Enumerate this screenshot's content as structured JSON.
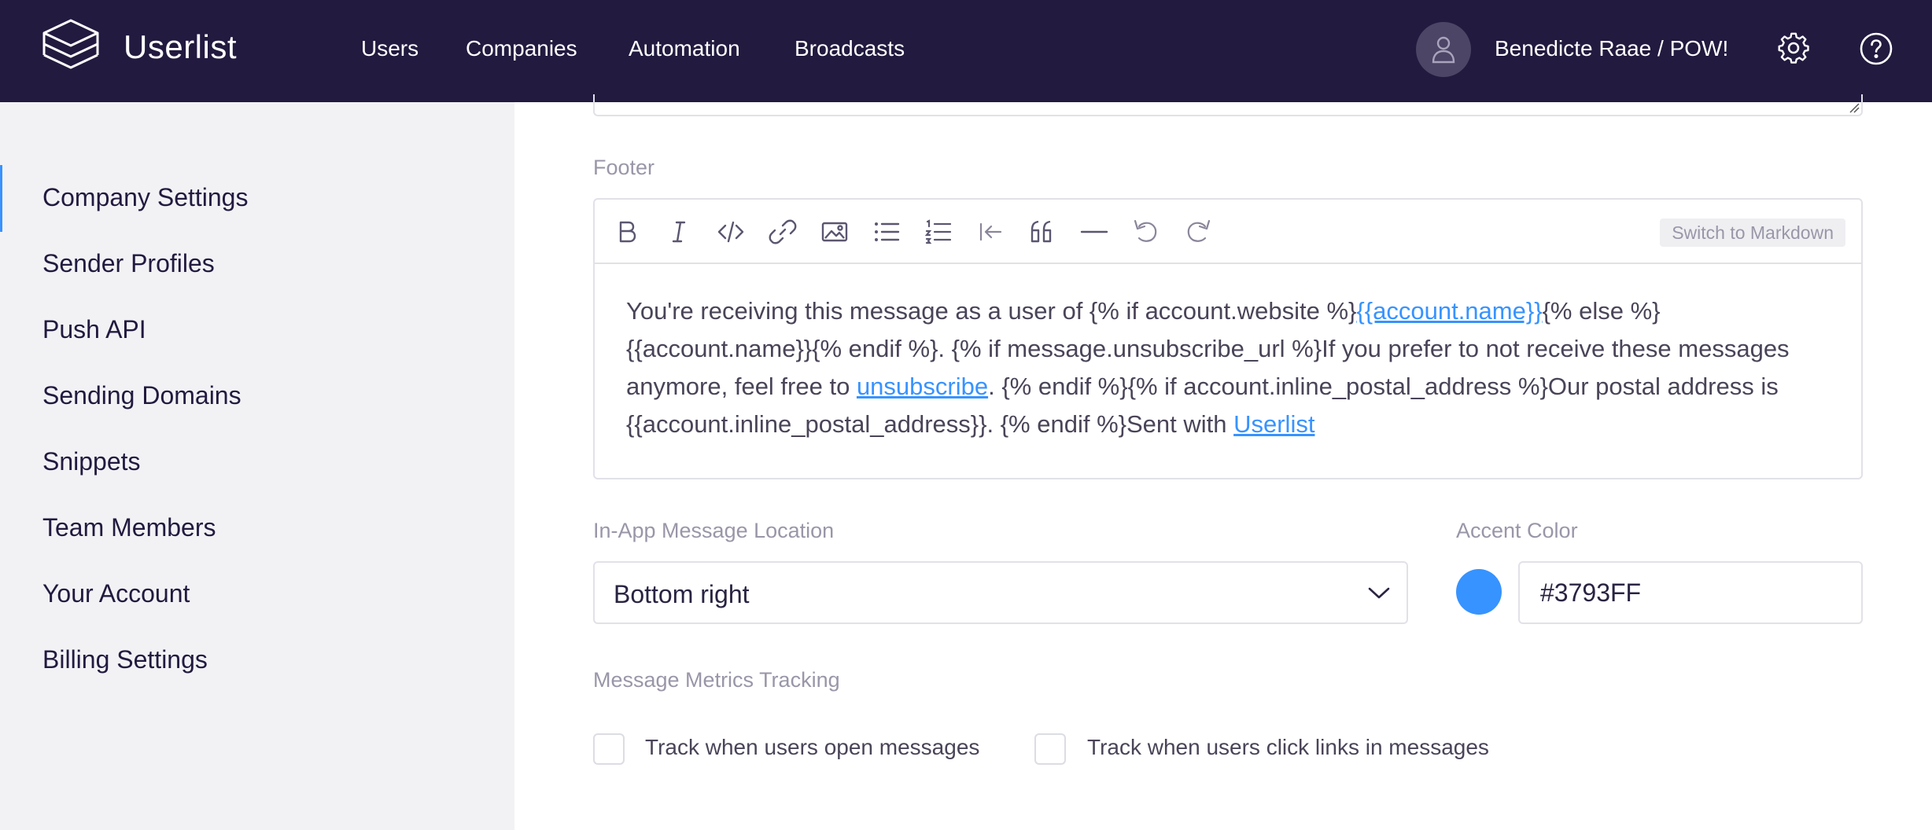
{
  "app": {
    "name": "Userlist"
  },
  "nav": {
    "items": [
      {
        "label": "Users"
      },
      {
        "label": "Companies"
      },
      {
        "label": "Automation"
      },
      {
        "label": "Broadcasts"
      }
    ],
    "account_name": "Benedicte Raae / POW!",
    "icons": [
      "user-icon",
      "gear-icon",
      "help-icon"
    ]
  },
  "sidebar": {
    "active": "Company Settings",
    "items": [
      {
        "label": "Company Settings"
      },
      {
        "label": "Sender Profiles"
      },
      {
        "label": "Push API"
      },
      {
        "label": "Sending Domains"
      },
      {
        "label": "Snippets"
      },
      {
        "label": "Team Members"
      },
      {
        "label": "Your Account"
      },
      {
        "label": "Billing Settings"
      }
    ]
  },
  "footer": {
    "label": "Footer",
    "toolbar_icons": [
      "bold-icon",
      "italic-icon",
      "code-icon",
      "link-icon",
      "image-icon",
      "bullet-list-icon",
      "numbered-list-icon",
      "outdent-icon",
      "quote-icon",
      "horizontal-rule-icon",
      "undo-icon",
      "redo-icon"
    ],
    "switch_label": "Switch to Markdown",
    "content": {
      "p1": "You're receiving this message as a user of {% if account.website %}",
      "link1": "{{account.name}}",
      "p2": "{% else %} {{account.name}}{% endif %}. {% if message.unsubscribe_url %}If you prefer to not receive these messages anymore, feel free to ",
      "link2": "unsubscribe",
      "p3": ". {% endif %}{% if account.inline_postal_address %}Our postal address is {{account.inline_postal_address}}. {% endif %}Sent with ",
      "link3": "Userlist"
    }
  },
  "in_app": {
    "label": "In-App Message Location",
    "value": "Bottom right"
  },
  "accent": {
    "label": "Accent Color",
    "value": "#3793FF",
    "color": "#3793ff"
  },
  "metrics": {
    "label": "Message Metrics Tracking",
    "open_label": "Track when users open messages",
    "click_label": "Track when users click links in messages",
    "open_checked": false,
    "click_checked": false
  },
  "colors": {
    "nav_bg": "#221a3f",
    "sidebar_bg": "#f2f2f5",
    "accent": "#3793ff"
  }
}
